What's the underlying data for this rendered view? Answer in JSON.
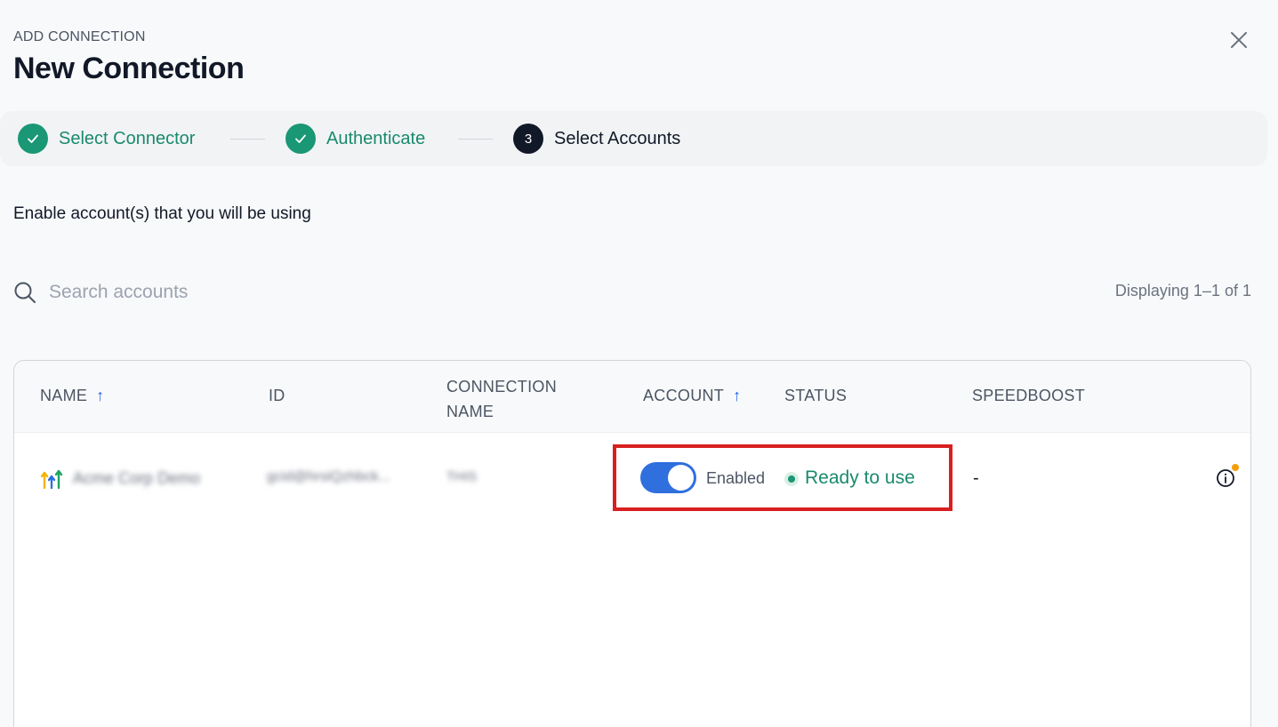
{
  "header": {
    "kicker": "ADD CONNECTION",
    "title": "New Connection"
  },
  "close_icon": "close-icon",
  "stepper": {
    "steps": [
      {
        "label": "Select Connector",
        "state": "done"
      },
      {
        "label": "Authenticate",
        "state": "done"
      },
      {
        "label": "Select Accounts",
        "state": "active",
        "number": "3"
      }
    ]
  },
  "instruction": "Enable account(s) that you will be using",
  "search": {
    "placeholder": "Search accounts",
    "value": ""
  },
  "displaying": "Displaying 1–1 of 1",
  "table": {
    "columns": {
      "name": "NAME",
      "id": "ID",
      "connection_name_1": "CONNECTION",
      "connection_name_2": "NAME",
      "account": "ACCOUNT",
      "status": "STATUS",
      "speedboost": "SPEEDBOOST"
    },
    "sort_arrow": "↑",
    "rows": [
      {
        "name": "Acme Corp Demo",
        "id": "gcid@hrsiQzhbck...",
        "connection_name": "THIS",
        "enabled": true,
        "toggle_label": "Enabled",
        "status": "Ready to use",
        "speedboost": "-"
      }
    ]
  },
  "colors": {
    "success": "#1a9775",
    "toggle_on": "#2f6fde",
    "highlight": "#d91f1f",
    "notification": "#f59e0b"
  }
}
